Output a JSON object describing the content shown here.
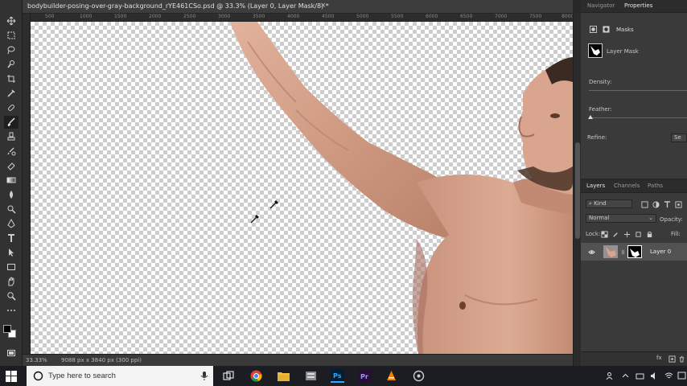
{
  "document": {
    "tab_title": "bodybuilder-posing-over-gray-background_rYE461CSo.psd @ 33.3% (Layer 0, Layer Mask/8) *",
    "close_glyph": "×",
    "zoom": "33.33%",
    "doc_info": "9088 px x 3840 px (300 ppi)",
    "ruler_labels": [
      "500",
      "1000",
      "1500",
      "2000",
      "2500",
      "3000",
      "3500",
      "4000",
      "4500",
      "5000",
      "5500",
      "6000",
      "6500",
      "7000",
      "7500",
      "8000"
    ]
  },
  "right_panel": {
    "top_tabs": [
      "Navigator",
      "Properties"
    ],
    "masks_label": "Masks",
    "layer_mask_label": "Layer Mask",
    "density_label": "Density:",
    "feather_label": "Feather:",
    "refine_label": "Refine:",
    "refine_button": "Se",
    "layer_tabs": [
      "Layers",
      "Channels",
      "Paths"
    ],
    "kind_label": "Kind",
    "blend_mode": "Normal",
    "opacity_label": "Opacity:",
    "lock_label": "Lock:",
    "fill_label": "Fill:",
    "layer_name": "Layer 0",
    "fx_label": "fx"
  },
  "taskbar": {
    "search_placeholder": "Type here to search"
  },
  "colors": {
    "accent_ps": "#31a8ff",
    "accent_pr": "#9999ff",
    "skin": "#d9a58e"
  }
}
